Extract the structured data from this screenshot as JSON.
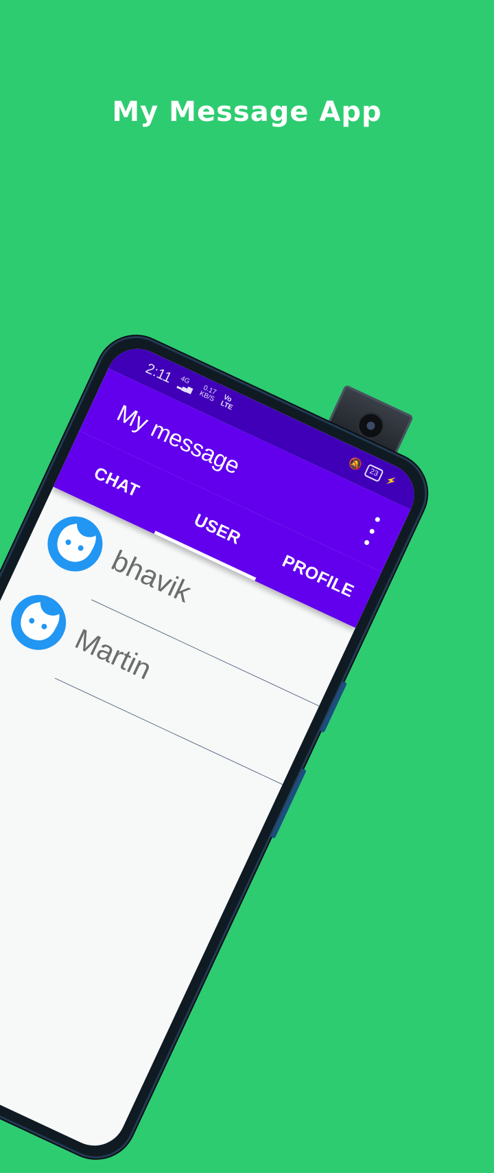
{
  "promo": {
    "headline": "My Message App"
  },
  "status_bar": {
    "time": "2:11",
    "network": "4G",
    "speed_value": "0.17",
    "speed_unit": "KB/S",
    "volte": "Vo\nLTE",
    "battery": "23"
  },
  "toolbar": {
    "title": "My message",
    "overflow_icon": "more-vert-icon"
  },
  "tabs": [
    {
      "label": "CHAT",
      "active": false
    },
    {
      "label": "USER",
      "active": true
    },
    {
      "label": "PROFILE",
      "active": false
    }
  ],
  "users": [
    {
      "name": "bhavik",
      "avatar_icon": "face-icon"
    },
    {
      "name": "Martin",
      "avatar_icon": "face-icon"
    }
  ],
  "colors": {
    "background": "#2ecc71",
    "primary": "#6200ee",
    "primary_dark": "#3f00b7",
    "avatar": "#2196f3"
  }
}
